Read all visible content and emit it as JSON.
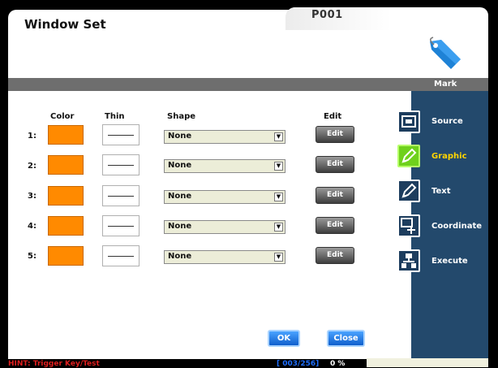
{
  "window": {
    "title": "Window Set",
    "page_code": "P001"
  },
  "panel": {
    "name": "Mark"
  },
  "columns": {
    "color": "Color",
    "thin": "Thin",
    "shape": "Shape",
    "edit": "Edit"
  },
  "rows": [
    {
      "label": "1:",
      "color": "#ff8a00",
      "shape": "None",
      "edit": "Edit"
    },
    {
      "label": "2:",
      "color": "#ff8a00",
      "shape": "None",
      "edit": "Edit"
    },
    {
      "label": "3:",
      "color": "#ff8a00",
      "shape": "None",
      "edit": "Edit"
    },
    {
      "label": "4:",
      "color": "#ff8a00",
      "shape": "None",
      "edit": "Edit"
    },
    {
      "label": "5:",
      "color": "#ff8a00",
      "shape": "None",
      "edit": "Edit"
    }
  ],
  "buttons": {
    "ok": "OK",
    "close": "Close"
  },
  "sidebar": {
    "items": [
      {
        "label": "Source",
        "icon": "source-icon",
        "active": false
      },
      {
        "label": "Graphic",
        "icon": "pencil-icon",
        "active": true
      },
      {
        "label": "Text",
        "icon": "pencil-icon",
        "active": false
      },
      {
        "label": "Coordinate",
        "icon": "coordinate-icon",
        "active": false
      },
      {
        "label": "Execute",
        "icon": "execute-icon",
        "active": false
      }
    ]
  },
  "status": {
    "hint": "HINT: Trigger Key/Test",
    "counter": "[ 003/256]",
    "percent": "0 %"
  },
  "colors": {
    "accent_orange": "#ff8a00",
    "sidebar_blue": "#23496c",
    "active_green": "#6fd11c",
    "hint_red": "#e02020"
  }
}
